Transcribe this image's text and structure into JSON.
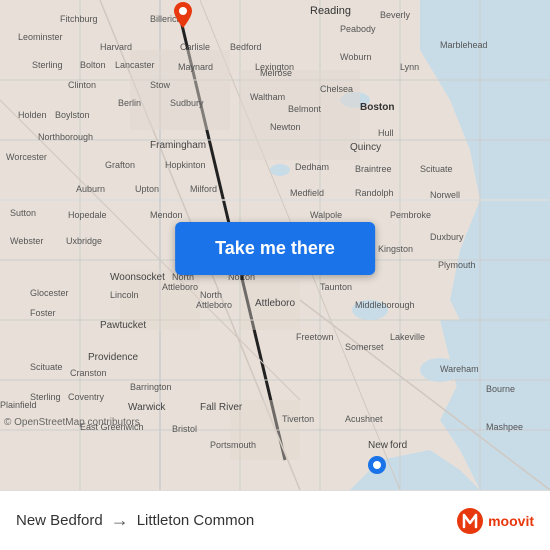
{
  "map": {
    "attribution": "© OpenStreetMap contributors",
    "background_color": "#e8e0d8"
  },
  "button": {
    "label": "Take me there"
  },
  "bottom_bar": {
    "origin": "New Bedford",
    "destination": "Littleton Common",
    "arrow": "→",
    "moovit_logo_text": "moovit"
  },
  "pins": {
    "top_color": "#e8380d",
    "bottom_color": "#1a73e8"
  },
  "route": {
    "top_pin_label": "Reading"
  }
}
